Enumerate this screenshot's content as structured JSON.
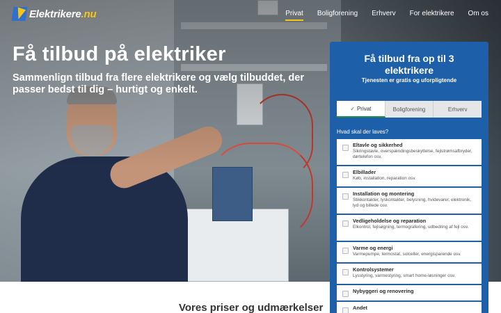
{
  "logo": {
    "name": "Elektrikere",
    "tld": ".nu"
  },
  "nav": {
    "items": [
      {
        "label": "Privat",
        "active": true
      },
      {
        "label": "Boligforening"
      },
      {
        "label": "Erhverv"
      },
      {
        "label": "For elektrikere"
      },
      {
        "label": "Om os"
      }
    ]
  },
  "hero": {
    "title": "Få tilbud på elektriker",
    "subtitle": "Sammenlign tilbud fra flere elektrikere og vælg tilbuddet, der passer bedst til dig – hurtigt og enkelt."
  },
  "form": {
    "title": "Få tilbud fra op til 3 elektrikere",
    "subtitle": "Tjenesten er gratis og uforpligtende",
    "tabs": [
      {
        "label": "Privat",
        "active": true
      },
      {
        "label": "Boligforening"
      },
      {
        "label": "Erhverv"
      }
    ],
    "question": "Hvad skal der laves?",
    "options": [
      {
        "title": "Eltavle og sikkerhed",
        "desc": "Sikringstavle, overspændingsbeskyttelse, fejlstrømsafbryder, dørtelefon osv."
      },
      {
        "title": "Elbillader",
        "desc": "Køb, installation, reparation osv."
      },
      {
        "title": "Installation og montering",
        "desc": "Stikkontakter, lyskontakter, belysning, hvidevarer, elektronik, lyd og billede osv."
      },
      {
        "title": "Vedligeholdelse og reparation",
        "desc": "Elkontrol, fejlsøgning, termografering, udbedring af fejl osv."
      },
      {
        "title": "Varme og energi",
        "desc": "Varmepumpe, termostat, solceller, energisparende osv."
      },
      {
        "title": "Kontrolsystemer",
        "desc": "Lysstyring, varmestyring, smart home-løsninger osv."
      },
      {
        "title": "Nybyggeri og renovering",
        "desc": ""
      },
      {
        "title": "Andet",
        "desc": ""
      }
    ]
  },
  "section": {
    "title": "Vores priser og udmærkelser"
  },
  "colors": {
    "brand_blue": "#1d5fa8",
    "accent_yellow": "#f5c518",
    "active_green": "#1e8f4d"
  }
}
